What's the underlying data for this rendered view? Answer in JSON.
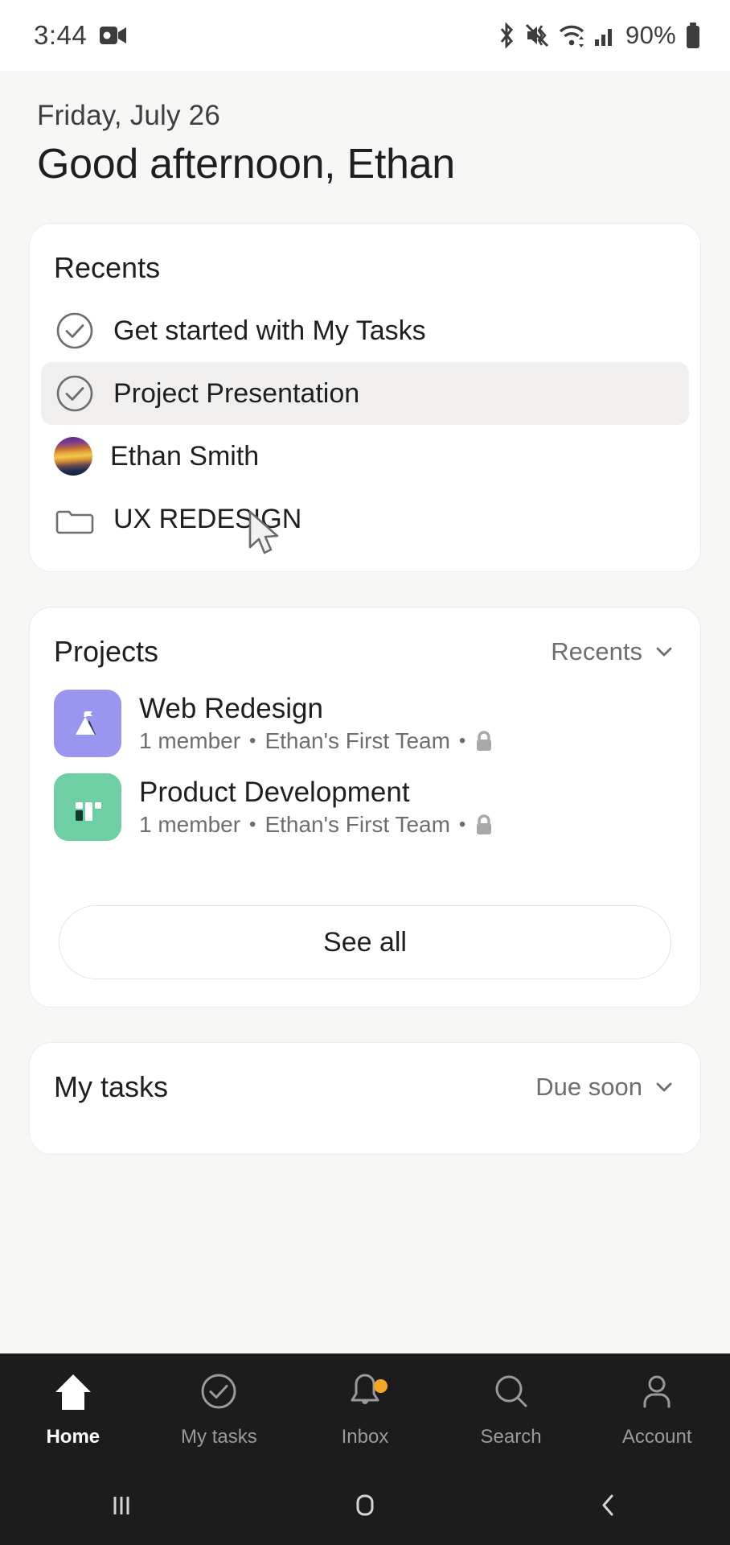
{
  "statusbar": {
    "time": "3:44",
    "battery_percent": "90%",
    "icons": [
      "video-recording-icon",
      "bluetooth-icon",
      "mute-vibrate-icon",
      "wifi-icon",
      "cellular-signal-icon",
      "battery-icon"
    ]
  },
  "greeting": {
    "date": "Friday, July 26",
    "message": "Good afternoon, Ethan"
  },
  "recents_card": {
    "title": "Recents",
    "items": [
      {
        "label": "Get started with My Tasks",
        "icon": "check-circle-icon",
        "highlighted": false
      },
      {
        "label": "Project Presentation",
        "icon": "check-circle-icon",
        "highlighted": true
      },
      {
        "label": "Ethan Smith",
        "icon": "avatar-image",
        "highlighted": false
      },
      {
        "label": "UX REDESIGN",
        "icon": "folder-icon",
        "highlighted": false
      }
    ]
  },
  "projects_card": {
    "title": "Projects",
    "sort_label": "Recents",
    "sort_icon": "chevron-down-icon",
    "items": [
      {
        "name": "Web Redesign",
        "members": "1 member",
        "team": "Ethan's First Team",
        "privacy_icon": "lock-icon",
        "icon_name": "mountain-flag-icon",
        "icon_bg": "#9a96f0",
        "icon_fg": "#ffffff",
        "icon_accent": "#2e3449"
      },
      {
        "name": "Product Development",
        "members": "1 member",
        "team": "Ethan's First Team",
        "privacy_icon": "lock-icon",
        "icon_name": "board-columns-icon",
        "icon_bg": "#6ecfa4",
        "icon_fg": "#ffffff",
        "icon_accent": "#12392f"
      }
    ],
    "see_all_label": "See all"
  },
  "my_tasks_card": {
    "title": "My tasks",
    "sort_label": "Due soon",
    "sort_icon": "chevron-down-icon"
  },
  "bottom_nav": {
    "items": [
      {
        "label": "Home",
        "icon": "home-icon",
        "active": true,
        "badge": false
      },
      {
        "label": "My tasks",
        "icon": "check-circle-icon",
        "active": false,
        "badge": false
      },
      {
        "label": "Inbox",
        "icon": "bell-icon",
        "active": false,
        "badge": true
      },
      {
        "label": "Search",
        "icon": "search-icon",
        "active": false,
        "badge": false
      },
      {
        "label": "Account",
        "icon": "person-icon",
        "active": false,
        "badge": false
      }
    ]
  },
  "system_nav": {
    "recents_icon": "recents-bars-icon",
    "home_icon": "home-square-icon",
    "back_icon": "back-chevron-icon"
  },
  "colors": {
    "page_bg": "#f7f7f5",
    "card_bg": "#ffffff",
    "text_primary": "#1e1f21",
    "text_secondary": "#6e6e6e",
    "nav_bg": "#1c1c1c",
    "badge": "#f5a623"
  }
}
